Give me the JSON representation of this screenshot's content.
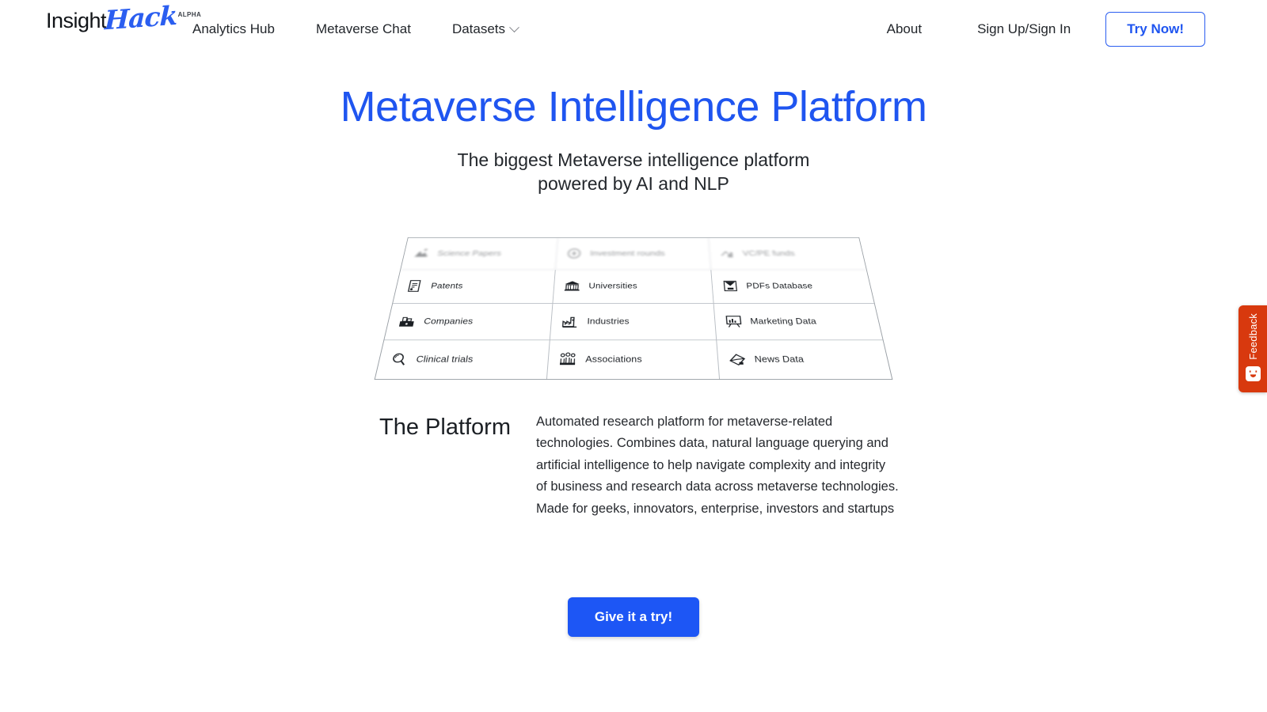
{
  "brand": {
    "name_primary": "Insight",
    "name_accent": "Hack",
    "badge": "ALPHA",
    "accent_color": "#2b5ef0"
  },
  "nav": {
    "left_items": [
      {
        "label": "Analytics Hub",
        "has_dropdown": false
      },
      {
        "label": "Metaverse Chat",
        "has_dropdown": false
      },
      {
        "label": "Datasets",
        "has_dropdown": true,
        "icon": "chevron-down-icon"
      }
    ],
    "right_items": [
      {
        "label": "About"
      },
      {
        "label": "Sign Up/Sign In"
      }
    ],
    "cta": {
      "label": "Try Now!",
      "style": "outline",
      "color": "#1f55f0"
    }
  },
  "hero": {
    "title": "Metaverse Intelligence Platform",
    "title_color": "#1f55f0",
    "subtitle_line1": "The biggest Metaverse intelligence platform",
    "subtitle_line2": "powered by AI and NLP"
  },
  "grid": {
    "columns": 3,
    "rows": 4,
    "cells": [
      {
        "label": "Science Papers",
        "icon": "science-papers-icon",
        "blurred": true
      },
      {
        "label": "Investment rounds",
        "icon": "investment-rounds-icon",
        "blurred": true
      },
      {
        "label": "VC/PE funds",
        "icon": "vc-pe-funds-icon",
        "blurred": true
      },
      {
        "label": "Patents",
        "icon": "patents-icon",
        "blurred": false
      },
      {
        "label": "Universities",
        "icon": "universities-icon",
        "blurred": false
      },
      {
        "label": "PDFs Database",
        "icon": "pdfs-database-icon",
        "blurred": false
      },
      {
        "label": "Companies",
        "icon": "companies-icon",
        "blurred": false
      },
      {
        "label": "Industries",
        "icon": "industries-icon",
        "blurred": false
      },
      {
        "label": "Marketing Data",
        "icon": "marketing-data-icon",
        "blurred": false
      },
      {
        "label": "Clinical trials",
        "icon": "clinical-trials-icon",
        "blurred": false
      },
      {
        "label": "Associations",
        "icon": "associations-icon",
        "blurred": false
      },
      {
        "label": "News Data",
        "icon": "news-data-icon",
        "blurred": false
      }
    ]
  },
  "platform": {
    "heading": "The Platform",
    "body": "Automated research platform for metaverse-related technologies. Combines data, natural language querying and artificial intelligence to help navigate complexity and integrity of business and research data across metaverse technologies. Made for geeks, innovators, enterprise, investors and startups"
  },
  "cta": {
    "label": "Give it a try!",
    "background": "#1d56f5",
    "text_color": "#ffffff"
  },
  "feedback": {
    "label": "Feedback",
    "icon": "smiley-face-icon",
    "background": "#d8390e"
  }
}
